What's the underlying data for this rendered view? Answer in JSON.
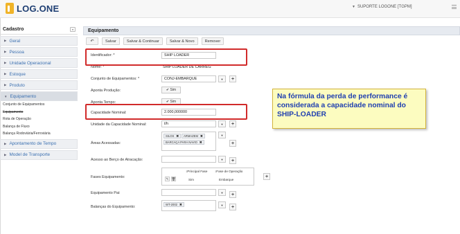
{
  "header": {
    "logo_text": "LOG.ONE",
    "user_label": "SUPORTE LOGONE [TGPM]"
  },
  "sidebar": {
    "title": "Cadastro",
    "collapse_label": "«",
    "items_top": [
      {
        "label": "Geral"
      },
      {
        "label": "Pessoa"
      },
      {
        "label": "Unidade Operacional"
      },
      {
        "label": "Estoque"
      },
      {
        "label": "Produto"
      }
    ],
    "active_item": {
      "label": "Equipamento"
    },
    "sub_items": [
      {
        "label": "Conjunto de Equipamentos"
      },
      {
        "label": "Equipamento"
      },
      {
        "label": "Rota de Operação"
      },
      {
        "label": "Balança de Fluxo"
      },
      {
        "label": "Balança Rodoviária/Ferroviária"
      }
    ],
    "items_bottom": [
      {
        "label": "Apontamento de Tempo"
      },
      {
        "label": "Model de Transporte"
      }
    ]
  },
  "main": {
    "title": "Equipamento",
    "toolbar": {
      "back_label": "↶",
      "save": "Salvar",
      "save_continue": "Salvar & Continuar",
      "save_new": "Salvar & Novo",
      "remove": "Remover"
    },
    "form": {
      "identificador": {
        "label": "Identificador: *",
        "value": "SHIP LOADER"
      },
      "nome": {
        "label": "Nome: *",
        "value": "SHIP LOADER DE CARREG"
      },
      "conjunto": {
        "label": "Conjunto de Equipamentos: *",
        "value": "CONJ-EMBARQUE"
      },
      "aponta_producao": {
        "label": "Aponta Produção:",
        "value": "✔ Sim"
      },
      "aponta_tempo": {
        "label": "Aponta Tempo:",
        "value": "✔ Sim"
      },
      "capacidade": {
        "label": "Capacidade Nominal:",
        "value": "2.000,000000"
      },
      "unidade": {
        "label": "Unidade da Capacidade Nominal:",
        "value": "t/h"
      },
      "areas": {
        "label": "Áreas Acessadas:",
        "tags": [
          "SILOS",
          "ARMAZEM",
          "BARCAÇA PARA NAVIO"
        ]
      },
      "acesso_berco": {
        "label": "Acesso ao Berço de Atracação:"
      },
      "fases": {
        "label": "Fases Equipamento:",
        "col_principal": "↕Principal Fase",
        "col_fase": "↕Fase de Operação",
        "row_principal": "Sim",
        "row_fase": "Embarque"
      },
      "equipamento_pai": {
        "label": "Equipamento Pai:"
      },
      "balancas": {
        "label": "Balanças do Equipamento:",
        "tags": [
          "WT-2002"
        ]
      }
    }
  },
  "note": {
    "text": "Na fórmula da perda de performance é considerada a capacidade nominal do SHIP-LOADER"
  },
  "colors": {
    "highlight": "#d12a2a",
    "note_bg": "#fcfcc0",
    "note_text": "#1f3fb0",
    "link": "#3a6fb0"
  }
}
